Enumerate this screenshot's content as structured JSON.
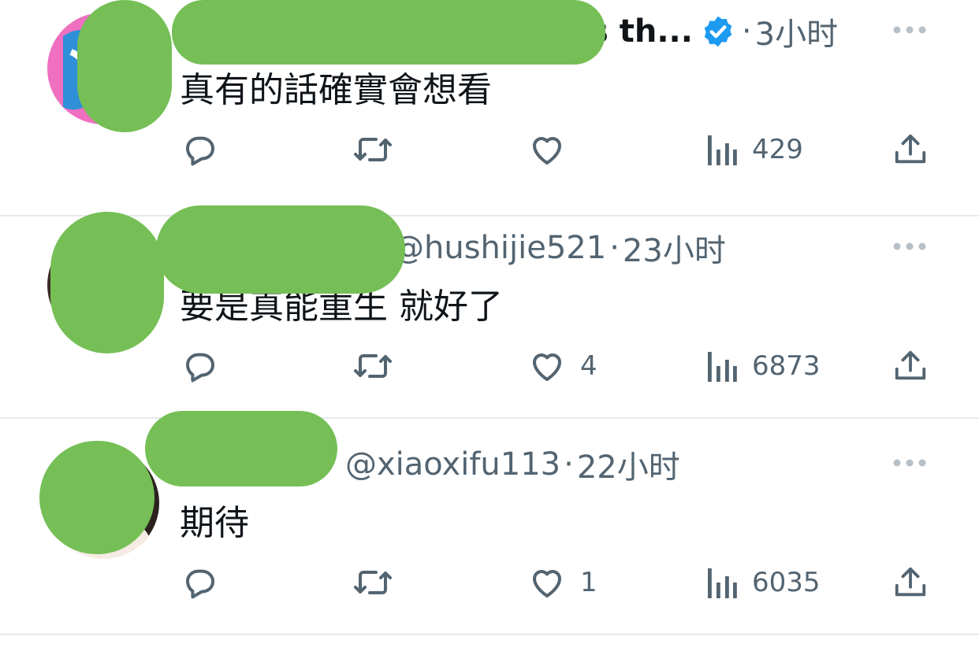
{
  "colors": {
    "accent_verified": "#1d9bf0",
    "muted_text": "#536471",
    "primary_text": "#0f1419",
    "divider": "#e7e9ea",
    "redaction_green": "#75bf56"
  },
  "replies": [
    {
      "display_name_visible": "s th...",
      "handle": "",
      "verified": true,
      "dot": "·",
      "time": "3小时",
      "text": "真有的話確實會想看",
      "stats": {
        "replies": "",
        "retweets": "",
        "likes": "",
        "views": "429"
      },
      "icons": [
        "reply-icon",
        "retweet-icon",
        "like-icon",
        "views-icon",
        "share-icon",
        "more-icon"
      ]
    },
    {
      "display_name_visible": "",
      "handle": "@hushijie521",
      "verified": false,
      "dot": "·",
      "time": "23小时",
      "text": "要是真能重生 就好了",
      "stats": {
        "replies": "",
        "retweets": "",
        "likes": "4",
        "views": "6873"
      },
      "icons": [
        "reply-icon",
        "retweet-icon",
        "like-icon",
        "views-icon",
        "share-icon",
        "more-icon"
      ]
    },
    {
      "display_name_visible": "",
      "handle": "@xiaoxifu113",
      "verified": false,
      "dot": "·",
      "time": "22小时",
      "text": "期待",
      "stats": {
        "replies": "",
        "retweets": "",
        "likes": "1",
        "views": "6035"
      },
      "icons": [
        "reply-icon",
        "retweet-icon",
        "like-icon",
        "views-icon",
        "share-icon",
        "more-icon"
      ]
    }
  ]
}
